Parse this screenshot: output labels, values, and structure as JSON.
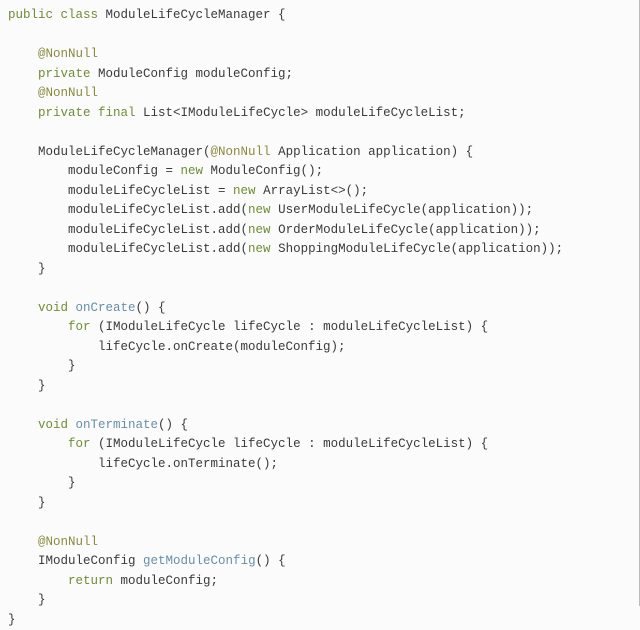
{
  "code": {
    "tokens": [
      {
        "cls": "kw",
        "t": "public "
      },
      {
        "cls": "kw",
        "t": "class "
      },
      {
        "cls": "id",
        "t": "ModuleLifeCycleManager {"
      },
      {
        "cls": "",
        "t": "\n"
      },
      {
        "cls": "",
        "t": "\n"
      },
      {
        "cls": "",
        "t": "    "
      },
      {
        "cls": "ann",
        "t": "@NonNull"
      },
      {
        "cls": "",
        "t": "\n"
      },
      {
        "cls": "",
        "t": "    "
      },
      {
        "cls": "kw",
        "t": "private "
      },
      {
        "cls": "id",
        "t": "ModuleConfig moduleConfig;"
      },
      {
        "cls": "",
        "t": "\n"
      },
      {
        "cls": "",
        "t": "    "
      },
      {
        "cls": "ann",
        "t": "@NonNull"
      },
      {
        "cls": "",
        "t": "\n"
      },
      {
        "cls": "",
        "t": "    "
      },
      {
        "cls": "kw",
        "t": "private final "
      },
      {
        "cls": "id",
        "t": "List<IModuleLifeCycle> moduleLifeCycleList;"
      },
      {
        "cls": "",
        "t": "\n"
      },
      {
        "cls": "",
        "t": "\n"
      },
      {
        "cls": "",
        "t": "    "
      },
      {
        "cls": "id",
        "t": "ModuleLifeCycleManager("
      },
      {
        "cls": "ann",
        "t": "@NonNull"
      },
      {
        "cls": "id",
        "t": " Application application) {"
      },
      {
        "cls": "",
        "t": "\n"
      },
      {
        "cls": "",
        "t": "        moduleConfig = "
      },
      {
        "cls": "kw",
        "t": "new "
      },
      {
        "cls": "id",
        "t": "ModuleConfig();"
      },
      {
        "cls": "",
        "t": "\n"
      },
      {
        "cls": "",
        "t": "        moduleLifeCycleList = "
      },
      {
        "cls": "kw",
        "t": "new "
      },
      {
        "cls": "id",
        "t": "ArrayList<>();"
      },
      {
        "cls": "",
        "t": "\n"
      },
      {
        "cls": "",
        "t": "        moduleLifeCycleList.add("
      },
      {
        "cls": "kw",
        "t": "new "
      },
      {
        "cls": "id",
        "t": "UserModuleLifeCycle(application));"
      },
      {
        "cls": "",
        "t": "\n"
      },
      {
        "cls": "",
        "t": "        moduleLifeCycleList.add("
      },
      {
        "cls": "kw",
        "t": "new "
      },
      {
        "cls": "id",
        "t": "OrderModuleLifeCycle(application));"
      },
      {
        "cls": "",
        "t": "\n"
      },
      {
        "cls": "",
        "t": "        moduleLifeCycleList.add("
      },
      {
        "cls": "kw",
        "t": "new "
      },
      {
        "cls": "id",
        "t": "ShoppingModuleLifeCycle(application));"
      },
      {
        "cls": "",
        "t": "\n"
      },
      {
        "cls": "",
        "t": "    }"
      },
      {
        "cls": "",
        "t": "\n"
      },
      {
        "cls": "",
        "t": "\n"
      },
      {
        "cls": "",
        "t": "    "
      },
      {
        "cls": "kw",
        "t": "void "
      },
      {
        "cls": "method",
        "t": "onCreate"
      },
      {
        "cls": "id",
        "t": "() {"
      },
      {
        "cls": "",
        "t": "\n"
      },
      {
        "cls": "",
        "t": "        "
      },
      {
        "cls": "kw",
        "t": "for "
      },
      {
        "cls": "id",
        "t": "(IModuleLifeCycle lifeCycle : moduleLifeCycleList) {"
      },
      {
        "cls": "",
        "t": "\n"
      },
      {
        "cls": "",
        "t": "            lifeCycle.onCreate(moduleConfig);"
      },
      {
        "cls": "",
        "t": "\n"
      },
      {
        "cls": "",
        "t": "        }"
      },
      {
        "cls": "",
        "t": "\n"
      },
      {
        "cls": "",
        "t": "    }"
      },
      {
        "cls": "",
        "t": "\n"
      },
      {
        "cls": "",
        "t": "\n"
      },
      {
        "cls": "",
        "t": "    "
      },
      {
        "cls": "kw",
        "t": "void "
      },
      {
        "cls": "method",
        "t": "onTerminate"
      },
      {
        "cls": "id",
        "t": "() {"
      },
      {
        "cls": "",
        "t": "\n"
      },
      {
        "cls": "",
        "t": "        "
      },
      {
        "cls": "kw",
        "t": "for "
      },
      {
        "cls": "id",
        "t": "(IModuleLifeCycle lifeCycle : moduleLifeCycleList) {"
      },
      {
        "cls": "",
        "t": "\n"
      },
      {
        "cls": "",
        "t": "            lifeCycle.onTerminate();"
      },
      {
        "cls": "",
        "t": "\n"
      },
      {
        "cls": "",
        "t": "        }"
      },
      {
        "cls": "",
        "t": "\n"
      },
      {
        "cls": "",
        "t": "    }"
      },
      {
        "cls": "",
        "t": "\n"
      },
      {
        "cls": "",
        "t": "\n"
      },
      {
        "cls": "",
        "t": "    "
      },
      {
        "cls": "ann",
        "t": "@NonNull"
      },
      {
        "cls": "",
        "t": "\n"
      },
      {
        "cls": "",
        "t": "    "
      },
      {
        "cls": "id",
        "t": "IModuleConfig "
      },
      {
        "cls": "method",
        "t": "getModuleConfig"
      },
      {
        "cls": "id",
        "t": "() {"
      },
      {
        "cls": "",
        "t": "\n"
      },
      {
        "cls": "",
        "t": "        "
      },
      {
        "cls": "kw",
        "t": "return "
      },
      {
        "cls": "id",
        "t": "moduleConfig;"
      },
      {
        "cls": "",
        "t": "\n"
      },
      {
        "cls": "",
        "t": "    }"
      },
      {
        "cls": "",
        "t": "\n"
      },
      {
        "cls": "",
        "t": "}"
      }
    ]
  }
}
